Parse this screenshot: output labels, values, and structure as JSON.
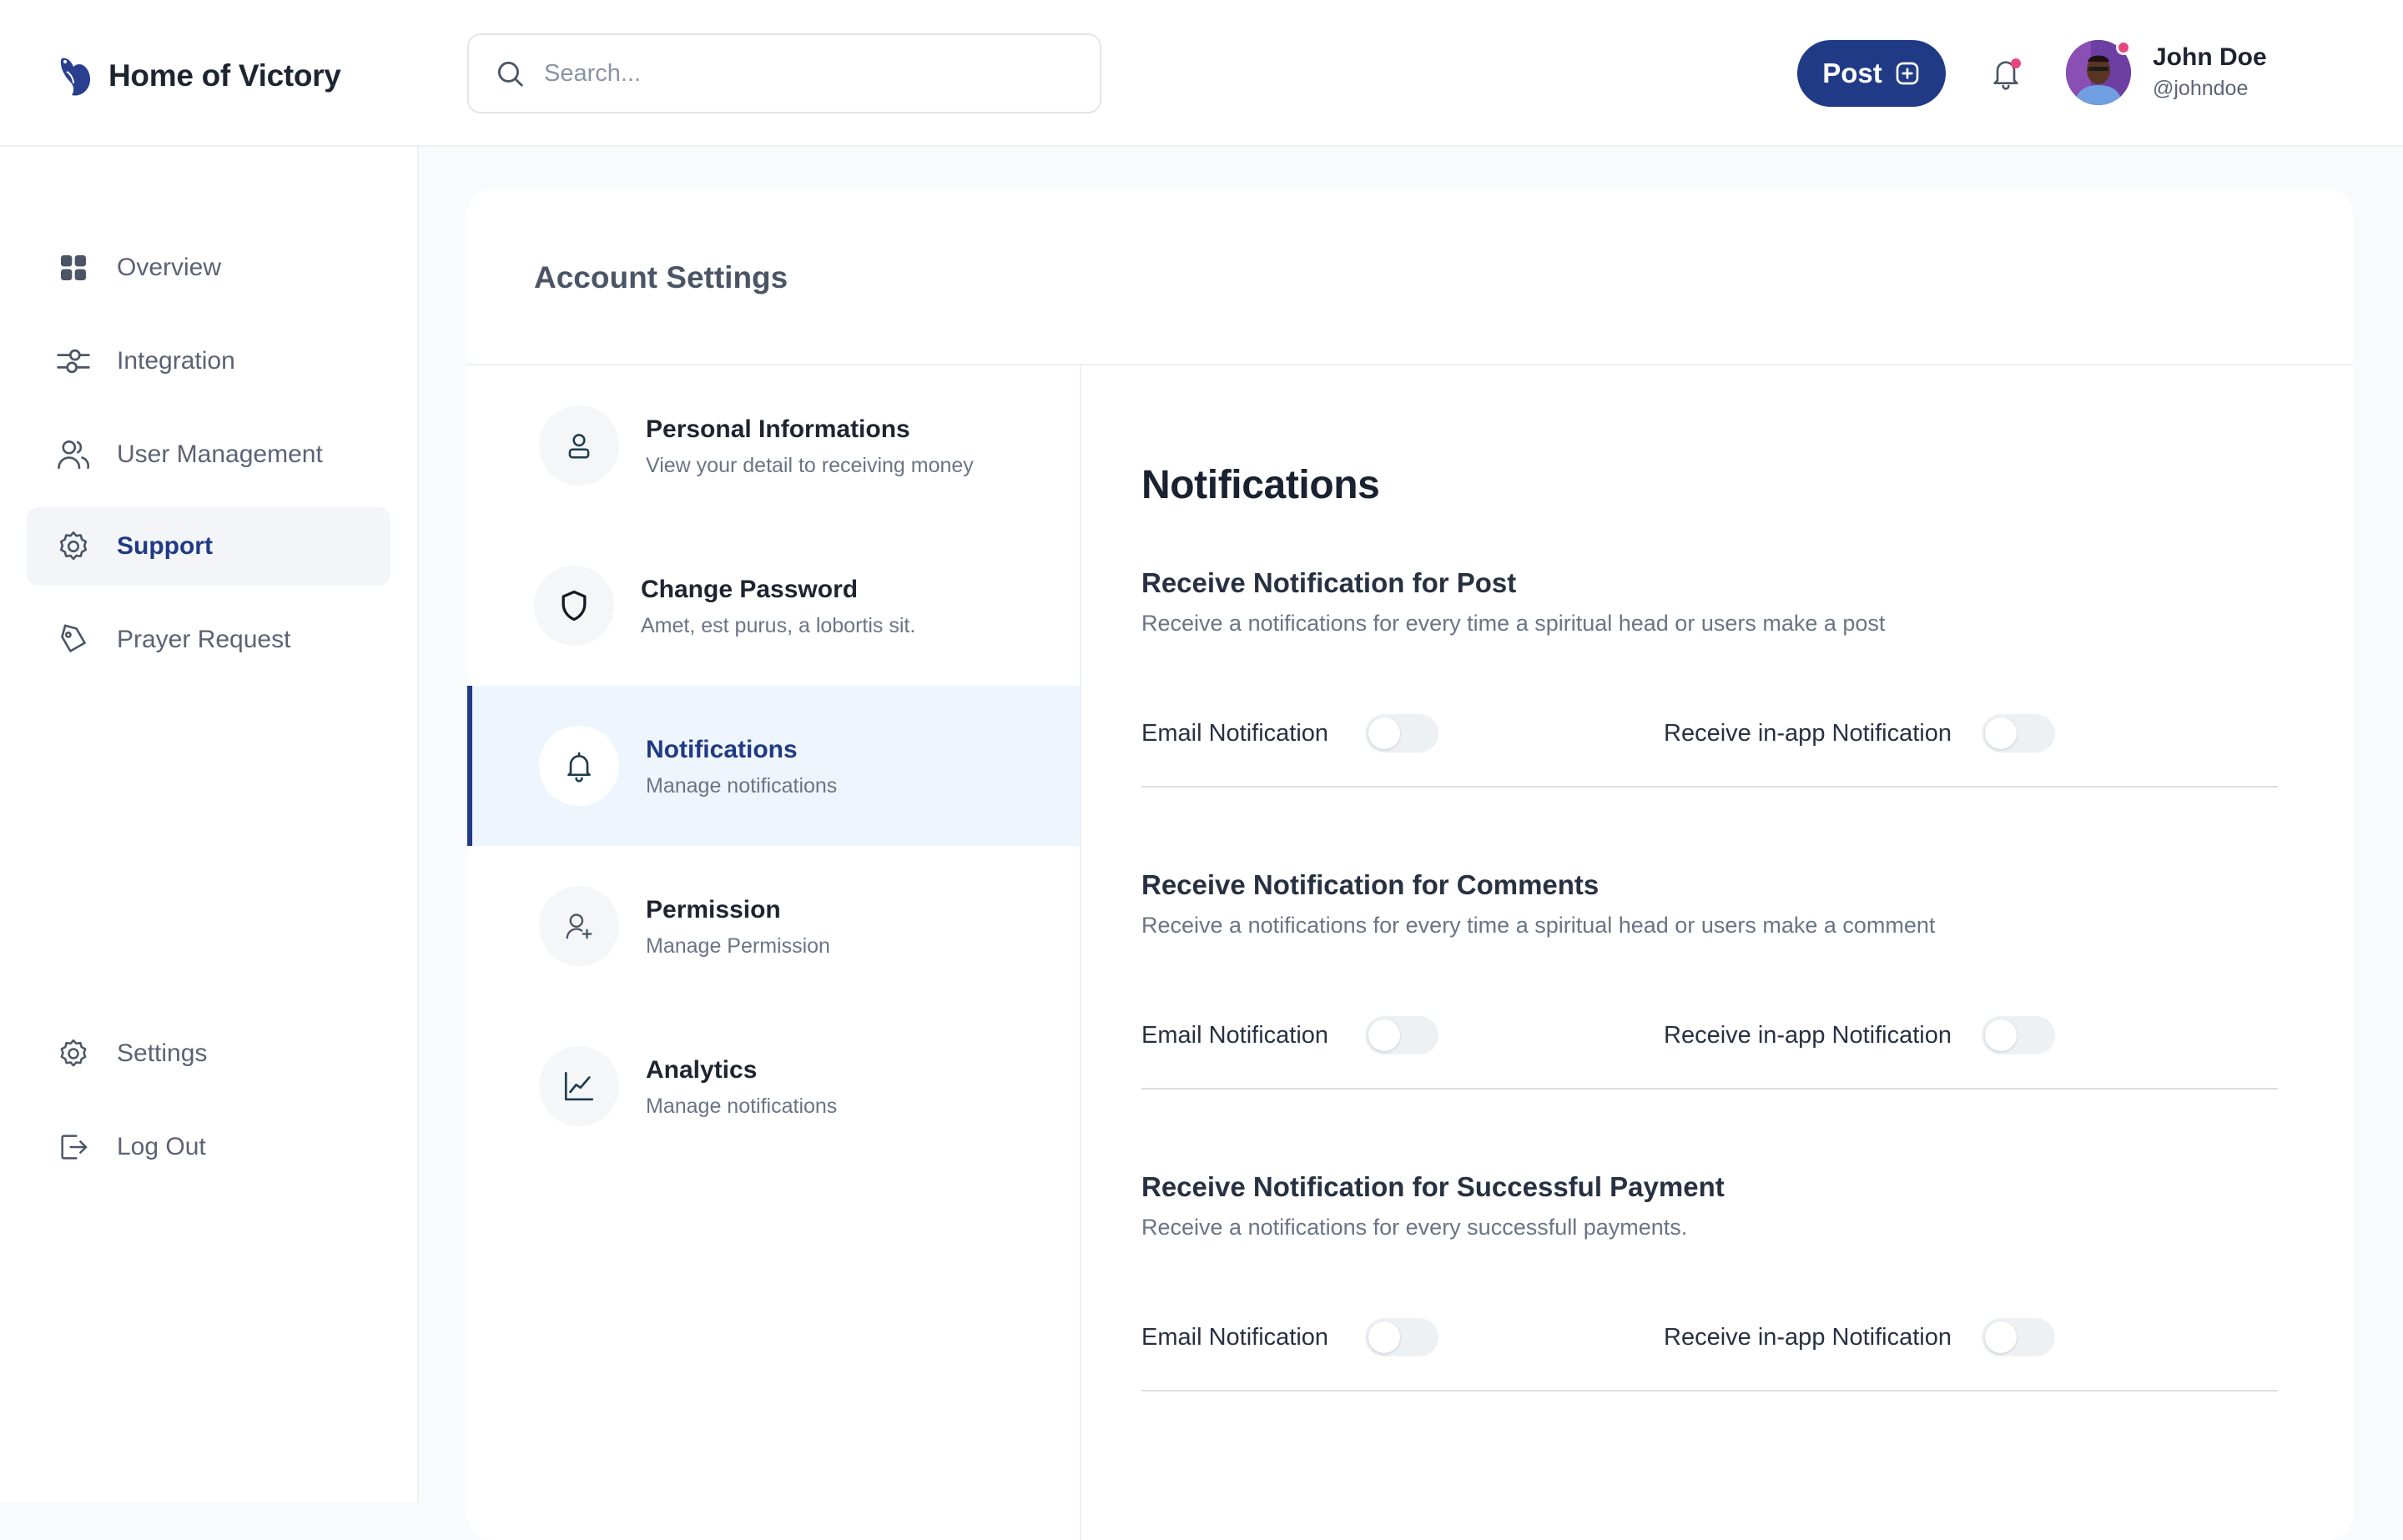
{
  "header": {
    "brand": "Home of Victory",
    "search_placeholder": "Search...",
    "post_label": "Post",
    "user": {
      "name": "John Doe",
      "handle": "@johndoe"
    }
  },
  "sidebar": {
    "items": [
      {
        "label": "Overview",
        "icon": "grid-icon"
      },
      {
        "label": "Integration",
        "icon": "sliders-icon"
      },
      {
        "label": "User Management",
        "icon": "users-icon"
      },
      {
        "label": "Support",
        "icon": "gear-icon",
        "active": true
      },
      {
        "label": "Prayer Request",
        "icon": "tag-icon"
      }
    ],
    "bottom_items": [
      {
        "label": "Settings",
        "icon": "gear-icon"
      },
      {
        "label": "Log Out",
        "icon": "logout-icon"
      }
    ]
  },
  "account": {
    "title": "Account Settings",
    "menu": [
      {
        "title": "Personal Informations",
        "subtitle": "View your detail to receiving money",
        "icon": "user-icon"
      },
      {
        "title": "Change Password",
        "subtitle": "Amet, est purus, a lobortis sit.",
        "icon": "shield-icon"
      },
      {
        "title": "Notifications",
        "subtitle": "Manage notifications",
        "icon": "bell-icon",
        "active": true
      },
      {
        "title": "Permission",
        "subtitle": "Manage Permission",
        "icon": "user-plus-icon"
      },
      {
        "title": "Analytics",
        "subtitle": "Manage notifications",
        "icon": "chart-icon"
      }
    ]
  },
  "notifications": {
    "title": "Notifications",
    "email_label": "Email Notification",
    "inapp_label": "Receive in-app Notification",
    "sections": [
      {
        "title": "Receive Notification for Post",
        "description": "Receive a notifications for every time a spiritual head or users make a post",
        "email_on": false,
        "inapp_on": false
      },
      {
        "title": "Receive Notification for  Comments",
        "description": "Receive a notifications for every time a spiritual head or users make a comment",
        "email_on": false,
        "inapp_on": false
      },
      {
        "title": "Receive Notification for Successful Payment",
        "description": "Receive a notifications for every successfull payments.",
        "email_on": false,
        "inapp_on": false
      }
    ]
  },
  "colors": {
    "primary": "#203a85",
    "active_bg": "#eff5fd",
    "notification_dot": "#e8457d"
  }
}
